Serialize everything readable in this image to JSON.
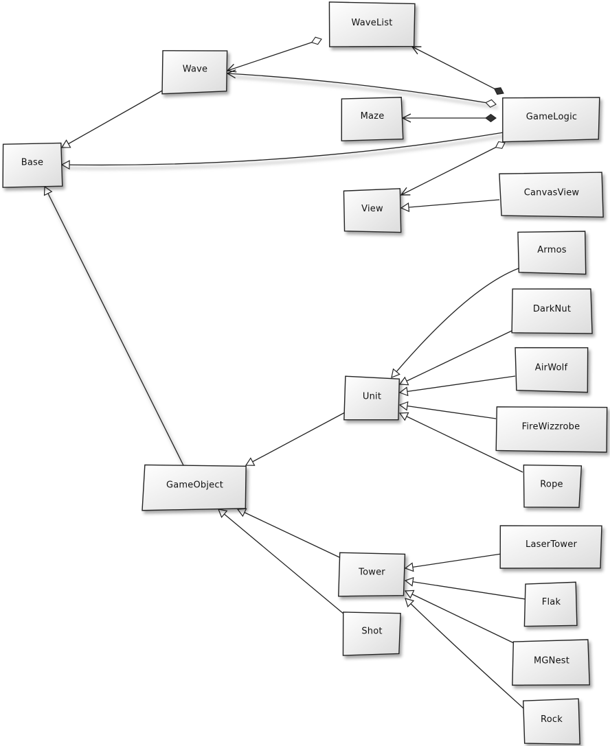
{
  "diagram": {
    "type": "uml-class-diagram",
    "classes": [
      {
        "id": "WaveList",
        "label": "WaveList"
      },
      {
        "id": "Wave",
        "label": "Wave"
      },
      {
        "id": "GameLogic",
        "label": "GameLogic"
      },
      {
        "id": "Maze",
        "label": "Maze"
      },
      {
        "id": "Base",
        "label": "Base"
      },
      {
        "id": "View",
        "label": "View"
      },
      {
        "id": "CanvasView",
        "label": "CanvasView"
      },
      {
        "id": "Armos",
        "label": "Armos"
      },
      {
        "id": "DarkNut",
        "label": "DarkNut"
      },
      {
        "id": "AirWolf",
        "label": "AirWolf"
      },
      {
        "id": "FireWizzrobe",
        "label": "FireWizzrobe"
      },
      {
        "id": "Rope",
        "label": "Rope"
      },
      {
        "id": "Unit",
        "label": "Unit"
      },
      {
        "id": "GameObject",
        "label": "GameObject"
      },
      {
        "id": "Tower",
        "label": "Tower"
      },
      {
        "id": "Shot",
        "label": "Shot"
      },
      {
        "id": "LaserTower",
        "label": "LaserTower"
      },
      {
        "id": "Flak",
        "label": "Flak"
      },
      {
        "id": "MGNest",
        "label": "MGNest"
      },
      {
        "id": "Rock",
        "label": "Rock"
      }
    ],
    "relations": [
      {
        "from": "WaveList",
        "to": "Wave",
        "kind": "aggregation",
        "source_end": "open-diamond",
        "target_end": "arrow"
      },
      {
        "from": "GameLogic",
        "to": "WaveList",
        "kind": "composition",
        "source_end": "filled-diamond",
        "target_end": "arrow"
      },
      {
        "from": "GameLogic",
        "to": "Wave",
        "kind": "aggregation",
        "source_end": "open-diamond",
        "target_end": "arrow"
      },
      {
        "from": "GameLogic",
        "to": "Maze",
        "kind": "composition",
        "source_end": "filled-diamond",
        "target_end": "arrow"
      },
      {
        "from": "GameLogic",
        "to": "View",
        "kind": "aggregation",
        "source_end": "open-diamond",
        "target_end": "arrow"
      },
      {
        "from": "GameLogic",
        "to": "Base",
        "kind": "generalization"
      },
      {
        "from": "Wave",
        "to": "Base",
        "kind": "generalization"
      },
      {
        "from": "GameObject",
        "to": "Base",
        "kind": "generalization"
      },
      {
        "from": "CanvasView",
        "to": "View",
        "kind": "generalization"
      },
      {
        "from": "Unit",
        "to": "GameObject",
        "kind": "generalization"
      },
      {
        "from": "Tower",
        "to": "GameObject",
        "kind": "generalization"
      },
      {
        "from": "Shot",
        "to": "GameObject",
        "kind": "generalization"
      },
      {
        "from": "Armos",
        "to": "Unit",
        "kind": "generalization"
      },
      {
        "from": "DarkNut",
        "to": "Unit",
        "kind": "generalization"
      },
      {
        "from": "AirWolf",
        "to": "Unit",
        "kind": "generalization"
      },
      {
        "from": "FireWizzrobe",
        "to": "Unit",
        "kind": "generalization"
      },
      {
        "from": "Rope",
        "to": "Unit",
        "kind": "generalization"
      },
      {
        "from": "LaserTower",
        "to": "Tower",
        "kind": "generalization"
      },
      {
        "from": "Flak",
        "to": "Tower",
        "kind": "generalization"
      },
      {
        "from": "MGNest",
        "to": "Tower",
        "kind": "generalization"
      },
      {
        "from": "Rock",
        "to": "Tower",
        "kind": "generalization"
      }
    ]
  }
}
